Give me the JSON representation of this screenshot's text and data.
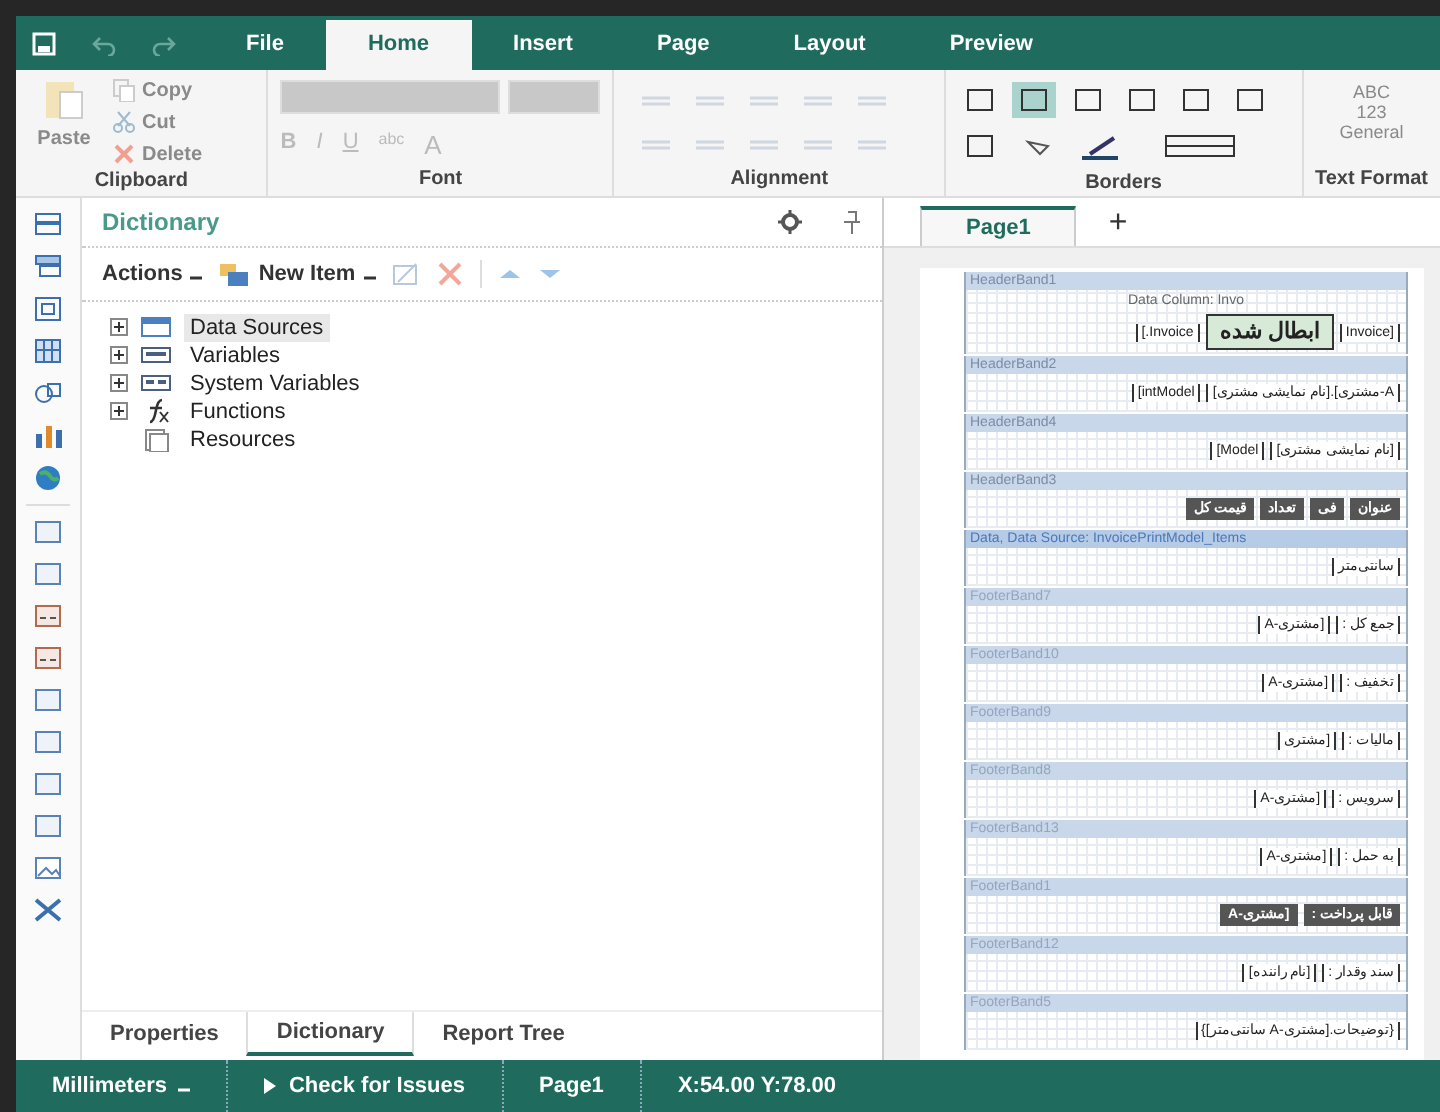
{
  "ribbon": {
    "tabs": [
      {
        "label": "File",
        "selected": false
      },
      {
        "label": "Home",
        "selected": true
      },
      {
        "label": "Insert",
        "selected": false
      },
      {
        "label": "Page",
        "selected": false
      },
      {
        "label": "Layout",
        "selected": false
      },
      {
        "label": "Preview",
        "selected": false
      }
    ],
    "clipboard": {
      "title": "Clipboard",
      "paste": {
        "label": "Paste",
        "disabled": true
      },
      "items": [
        {
          "label": "Copy",
          "disabled": true
        },
        {
          "label": "Cut",
          "disabled": true
        },
        {
          "label": "Delete",
          "disabled": true
        }
      ]
    },
    "font": {
      "title": "Font",
      "styles": [
        "B",
        "I",
        "U",
        "abc",
        "A"
      ]
    },
    "alignment": {
      "title": "Alignment"
    },
    "borders": {
      "title": "Borders"
    },
    "text_format": {
      "title": "Text Format",
      "icon_lines": [
        "ABC",
        "123",
        "General"
      ]
    }
  },
  "dictionary": {
    "title": "Dictionary",
    "actions": "Actions",
    "new_item": "New Item",
    "tree": [
      {
        "label": "Data Sources",
        "kind": "datasource",
        "expanded": false,
        "selected": true
      },
      {
        "label": "Variables",
        "kind": "variables",
        "expanded": false,
        "selected": false
      },
      {
        "label": "System Variables",
        "kind": "sysvars",
        "expanded": false,
        "selected": false
      },
      {
        "label": "Functions",
        "kind": "functions",
        "expanded": false,
        "selected": false
      },
      {
        "label": "Resources",
        "kind": "resources",
        "selected": false
      }
    ],
    "bottom_tabs": [
      {
        "label": "Properties",
        "selected": false
      },
      {
        "label": "Dictionary",
        "selected": true
      },
      {
        "label": "Report Tree",
        "selected": false
      }
    ]
  },
  "report": {
    "page_tab": "Page1",
    "add_tab": "+",
    "bands": [
      {
        "name": "HeaderBand1",
        "kind": "header",
        "caption": "Data Column: Invo",
        "items": [
          {
            "text": "[.Invoice",
            "kind": "field"
          },
          {
            "text": "ابطال شده",
            "kind": "title"
          },
          {
            "text": "Invoice]",
            "kind": "field"
          }
        ]
      },
      {
        "name": "HeaderBand2",
        "kind": "header",
        "items": [
          {
            "text": "[intModel",
            "kind": "field"
          },
          {
            "text": "[نام نمایشی مشتری].[مشتری-A",
            "kind": "field"
          }
        ]
      },
      {
        "name": "HeaderBand4",
        "kind": "header",
        "items": [
          {
            "text": "[Model",
            "kind": "field"
          },
          {
            "text": "[نام نمایشی مشتری]",
            "kind": "field"
          }
        ]
      },
      {
        "name": "HeaderBand3",
        "kind": "header",
        "items": [
          {
            "text": "عنوان",
            "kind": "heading"
          },
          {
            "text": "فی",
            "kind": "heading"
          },
          {
            "text": "تعداد",
            "kind": "heading"
          },
          {
            "text": "قیمت کل",
            "kind": "heading"
          }
        ]
      },
      {
        "name": "Data, Data Source: InvoicePrintModel_Items",
        "kind": "data",
        "items": [
          {
            "text": "سانتی‌متر",
            "kind": "field"
          }
        ]
      },
      {
        "name": "FooterBand7",
        "kind": "footer",
        "items": [
          {
            "text": "جمع کل :",
            "kind": "field"
          },
          {
            "text": "[مشتری-A",
            "kind": "field"
          }
        ]
      },
      {
        "name": "FooterBand10",
        "kind": "footer",
        "items": [
          {
            "text": "تخفیف :",
            "kind": "field"
          },
          {
            "text": "[مشتری-A",
            "kind": "field"
          }
        ]
      },
      {
        "name": "FooterBand9",
        "kind": "footer",
        "items": [
          {
            "text": "مالیات :",
            "kind": "field"
          },
          {
            "text": "[مشتری",
            "kind": "field"
          }
        ]
      },
      {
        "name": "FooterBand8",
        "kind": "footer",
        "items": [
          {
            "text": "سرویس :",
            "kind": "field"
          },
          {
            "text": "[مشتری-A",
            "kind": "field"
          }
        ]
      },
      {
        "name": "FooterBand13",
        "kind": "footer",
        "items": [
          {
            "text": "به حمل :",
            "kind": "field"
          },
          {
            "text": "[مشتری-A",
            "kind": "field"
          }
        ]
      },
      {
        "name": "FooterBand1",
        "kind": "footer",
        "items": [
          {
            "text": "قابل پرداخت :",
            "kind": "heading"
          },
          {
            "text": "[مشتری-A",
            "kind": "heading"
          }
        ]
      },
      {
        "name": "FooterBand12",
        "kind": "footer",
        "items": [
          {
            "text": "سند وقدار :",
            "kind": "field"
          },
          {
            "text": "[نام راننده]",
            "kind": "field"
          }
        ]
      },
      {
        "name": "FooterBand5",
        "kind": "footer",
        "items": [
          {
            "text": "{توضیحات.[مشتری-A سانتی‌متر]}",
            "kind": "field"
          }
        ]
      }
    ]
  },
  "status_bar": {
    "units": "Millimeters",
    "check": "Check for Issues",
    "page": "Page1",
    "position": "X:54.00 Y:78.00"
  }
}
